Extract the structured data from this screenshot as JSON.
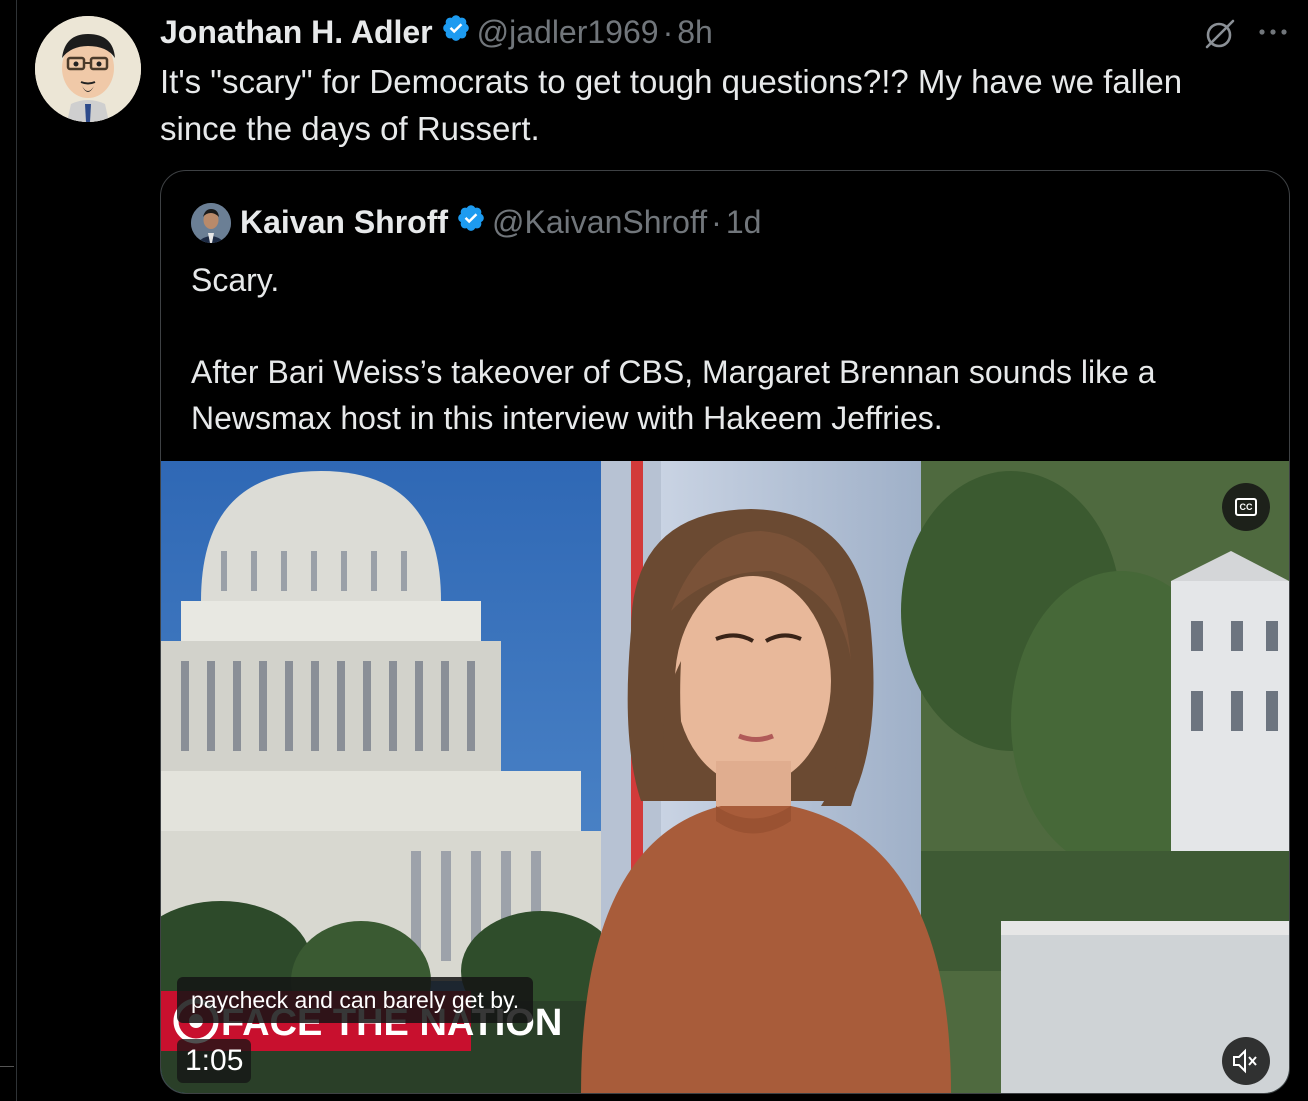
{
  "tweet": {
    "author_name": "Jonathan H. Adler",
    "handle": "@jadler1969",
    "separator": "·",
    "time": "8h",
    "text": "It's \"scary\" for Democrats to get tough questions?!? My have we fallen since the days of Russert.",
    "verified": true,
    "icons": [
      "grok-icon",
      "more-icon",
      "verified-badge-icon"
    ]
  },
  "quote": {
    "author_name": "Kaivan Shroff",
    "handle": "@KaivanShroff",
    "separator": "·",
    "time": "1d",
    "verified": true,
    "text_line1": "Scary.",
    "text_line2": "After Bari Weiss’s takeover of CBS, Margaret Brennan sounds like a Newsmax host in this interview with Hakeem Jeffries."
  },
  "video": {
    "cc_label": "CC",
    "caption": "paycheck and can barely get by.",
    "duration": "1:05",
    "watermark": "FACE THE NATION",
    "icons": [
      "cc-icon",
      "mute-icon"
    ]
  },
  "colors": {
    "background": "#000000",
    "text_primary": "#e7e9ea",
    "text_secondary": "#71767b",
    "verified_blue": "#1d9bf0",
    "border": "#2f3336",
    "cbs_red": "#c8102e"
  }
}
